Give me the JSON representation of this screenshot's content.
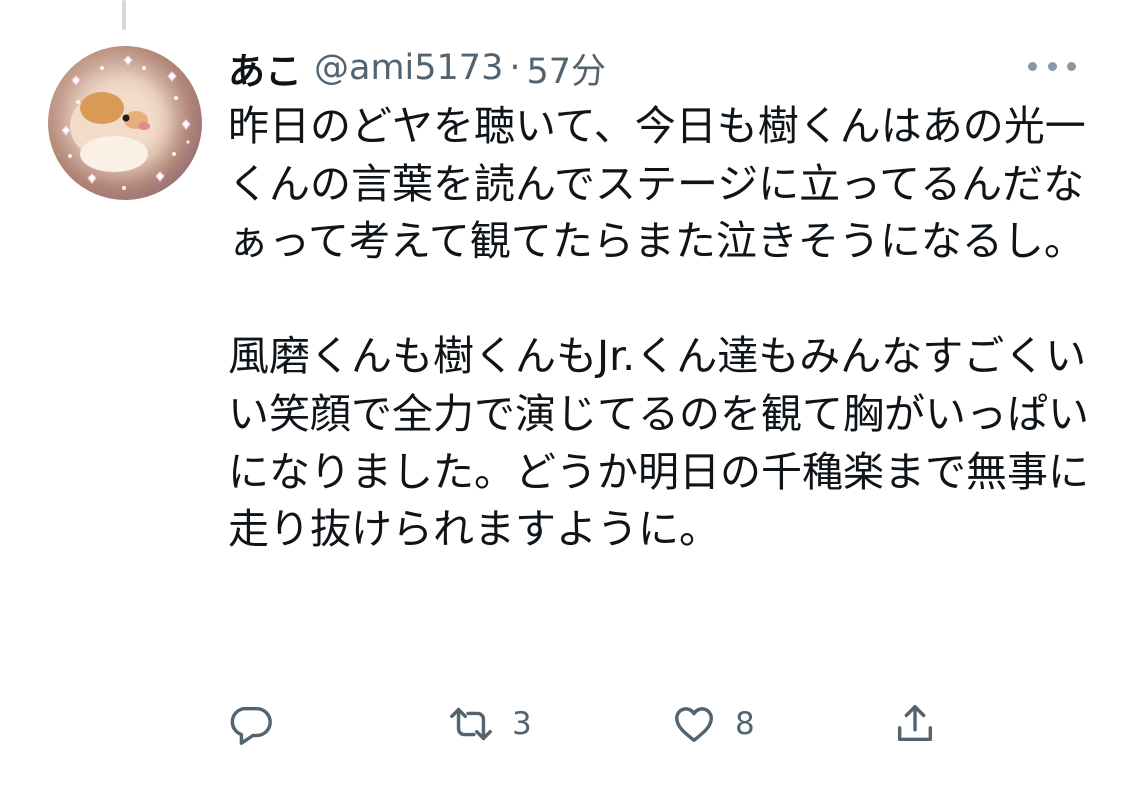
{
  "tweet": {
    "display_name": "あこ",
    "handle": "@ami5173",
    "separator": "·",
    "time": "57分",
    "paragraphs": [
      "昨日のどヤを聴いて、今日も樹くんはあの光一くんの言葉を読んでステージに立ってるんだなぁって考えて観てたらまた泣きそうになるし。",
      "風磨くんも樹くんもJr.くん達もみんなすごくいい笑顔で全力で演じてるのを観て胸がいっぱいになりました。どうか明日の千穐楽まで無事に走り抜けられますように。"
    ]
  },
  "actions": {
    "reply_icon": "speech-bubble-icon",
    "retweet_icon": "retweet-arrows-icon",
    "retweet_count": "3",
    "like_icon": "heart-outline-icon",
    "like_count": "8",
    "share_icon": "share-upload-icon"
  },
  "colors": {
    "text_primary": "#0f1419",
    "text_secondary": "#536471",
    "icon": "#536471",
    "thread_line": "#cfd9de"
  }
}
